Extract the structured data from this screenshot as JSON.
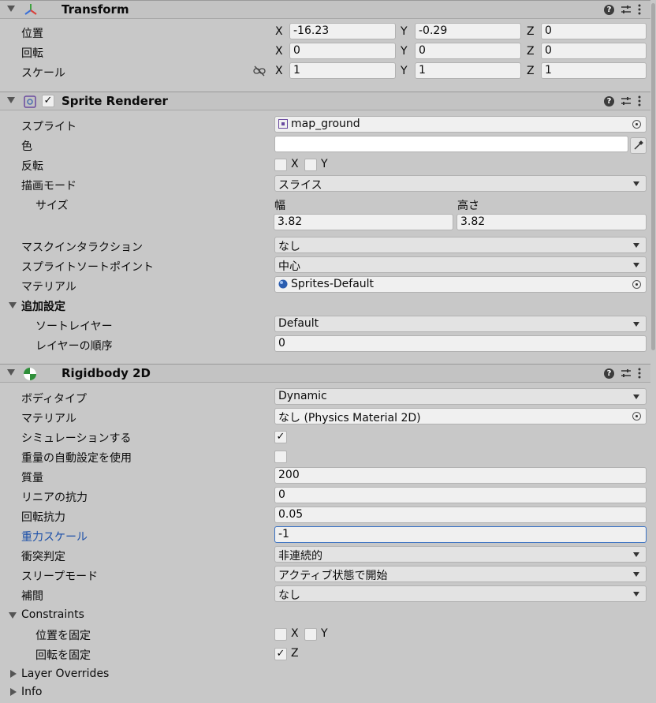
{
  "transform": {
    "title": "Transform",
    "position": {
      "label": "位置",
      "x": "-16.23",
      "y": "-0.29",
      "z": "0"
    },
    "rotation": {
      "label": "回転",
      "x": "0",
      "y": "0",
      "z": "0"
    },
    "scale": {
      "label": "スケール",
      "x": "1",
      "y": "1",
      "z": "1"
    },
    "axis_x": "X",
    "axis_y": "Y",
    "axis_z": "Z"
  },
  "sprite_renderer": {
    "title": "Sprite Renderer",
    "enabled_check": "✓",
    "sprite": {
      "label": "スプライト",
      "value": "map_ground"
    },
    "color": {
      "label": "色",
      "value": "#ffffff"
    },
    "flip": {
      "label": "反転",
      "x": "X",
      "y": "Y"
    },
    "draw_mode": {
      "label": "描画モード",
      "value": "スライス"
    },
    "size": {
      "label": "サイズ",
      "width_label": "幅",
      "height_label": "高さ",
      "width": "3.82",
      "height": "3.82"
    },
    "mask_interaction": {
      "label": "マスクインタラクション",
      "value": "なし"
    },
    "sort_point": {
      "label": "スプライトソートポイント",
      "value": "中心"
    },
    "material": {
      "label": "マテリアル",
      "value": "Sprites-Default"
    },
    "additional": {
      "label": "追加設定"
    },
    "sorting_layer": {
      "label": "ソートレイヤー",
      "value": "Default"
    },
    "order_in_layer": {
      "label": "レイヤーの順序",
      "value": "0"
    }
  },
  "rigidbody": {
    "title": "Rigidbody 2D",
    "body_type": {
      "label": "ボディタイプ",
      "value": "Dynamic"
    },
    "material": {
      "label": "マテリアル",
      "value": "なし (Physics Material 2D)"
    },
    "simulated": {
      "label": "シミュレーションする",
      "check": "✓"
    },
    "auto_mass": {
      "label": "重量の自動設定を使用",
      "check": ""
    },
    "mass": {
      "label": "質量",
      "value": "200"
    },
    "linear_drag": {
      "label": "リニアの抗力",
      "value": "0"
    },
    "angular_drag": {
      "label": "回転抗力",
      "value": "0.05"
    },
    "gravity_scale": {
      "label": "重力スケール",
      "value": "-1"
    },
    "collision_detection": {
      "label": "衝突判定",
      "value": "非連続的"
    },
    "sleeping_mode": {
      "label": "スリープモード",
      "value": "アクティブ状態で開始"
    },
    "interpolate": {
      "label": "補間",
      "value": "なし"
    },
    "constraints": {
      "label": "Constraints",
      "freeze_position": {
        "label": "位置を固定",
        "x": "X",
        "y": "Y"
      },
      "freeze_rotation": {
        "label": "回転を固定",
        "z": "Z",
        "check": "✓"
      }
    },
    "layer_overrides": "Layer Overrides",
    "info": "Info"
  },
  "colors": {
    "background": "#c8c8c8",
    "header": "#c3c3c3",
    "active_label": "#1b4fa8"
  }
}
